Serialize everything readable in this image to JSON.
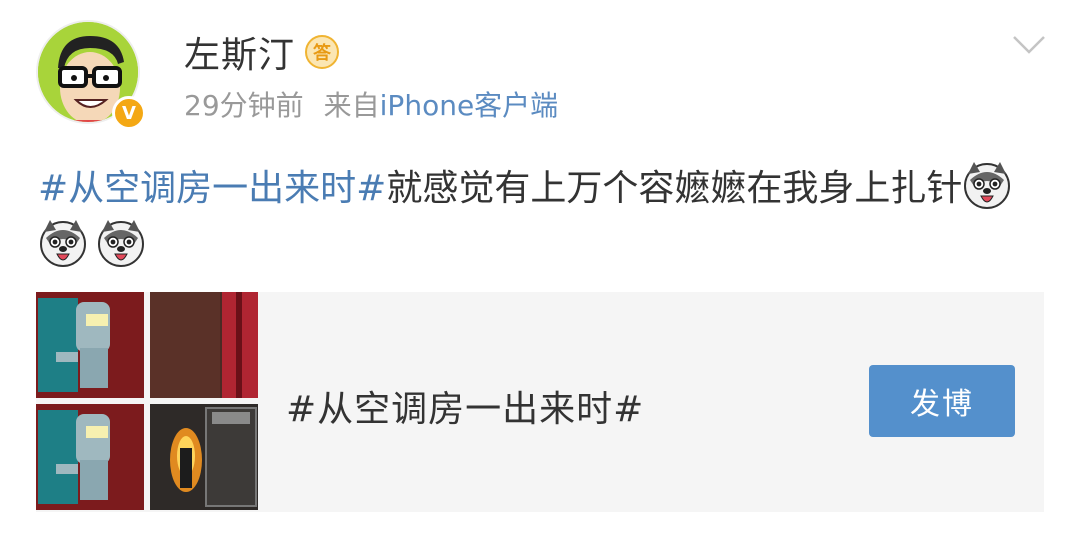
{
  "user": {
    "name": "左斯汀",
    "answer_badge": "答",
    "verified_mark": "V"
  },
  "meta": {
    "time": "29分钟前",
    "source_prefix": "来自",
    "client": "iPhone客户端"
  },
  "post": {
    "hashtag": "#从空调房一出来时#",
    "text": "就感觉有上万个容嬷嬷在我身上扎针",
    "emoji_icons": [
      "husky-face-icon",
      "husky-face-icon",
      "husky-face-icon"
    ]
  },
  "topic_card": {
    "title": "#从空调房一出来时#",
    "button_label": "发博"
  },
  "colors": {
    "link_blue": "#4a7cb3",
    "button_blue": "#5490cc",
    "meta_gray": "#999999",
    "verified_orange": "#f4a814"
  }
}
